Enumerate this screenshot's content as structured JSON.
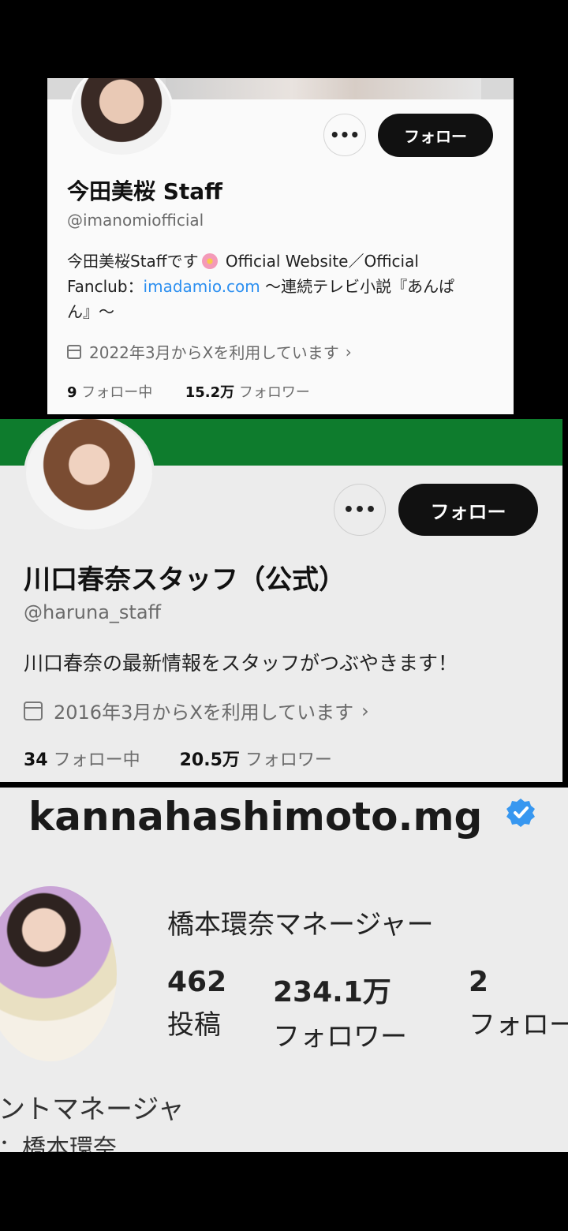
{
  "panel1": {
    "name": "今田美桜 Staff",
    "handle": "@imanomiofficial",
    "bio_before_icon": "今田美桜Staffです",
    "bio_after_icon": " Official Website／Official Fanclub：",
    "bio_link": "imadamio.com",
    "bio_tail": " 〜連続テレビ小説『あんぱん』〜",
    "joined": "2022年3月からXを利用しています",
    "following_count": "9",
    "following_label": " フォロー中",
    "followers_count": "15.2万",
    "followers_label": " フォロワー",
    "follow_button": "フォロー",
    "more_button": "•••",
    "icons": [
      "more-icon",
      "calendar-icon",
      "chevron-right-icon",
      "flower-emoji-icon"
    ]
  },
  "panel2": {
    "name": "川口春奈スタッフ（公式）",
    "handle": "@haruna_staff",
    "bio": "川口春奈の最新情報をスタッフがつぶやきます！",
    "joined": "2016年3月からXを利用しています",
    "following_count": "34",
    "following_label": " フォロー中",
    "followers_count": "20.5万",
    "followers_label": " フォロワー",
    "follow_button": "フォロー",
    "more_button": "•••",
    "banner_color": "#0e7c2d"
  },
  "panel3": {
    "username": "kannahashimoto.mg",
    "display_name": "橋本環奈マネージャー",
    "posts_count": "462",
    "posts_label": "投稿",
    "followers_count": "234.1万",
    "followers_label": "フォロワー",
    "following_count": "2",
    "following_label": "フォロー",
    "bio_line1": "ントマネージャ",
    "bio_line2": "：橋本環奈",
    "verified_color": "#3797f0"
  }
}
